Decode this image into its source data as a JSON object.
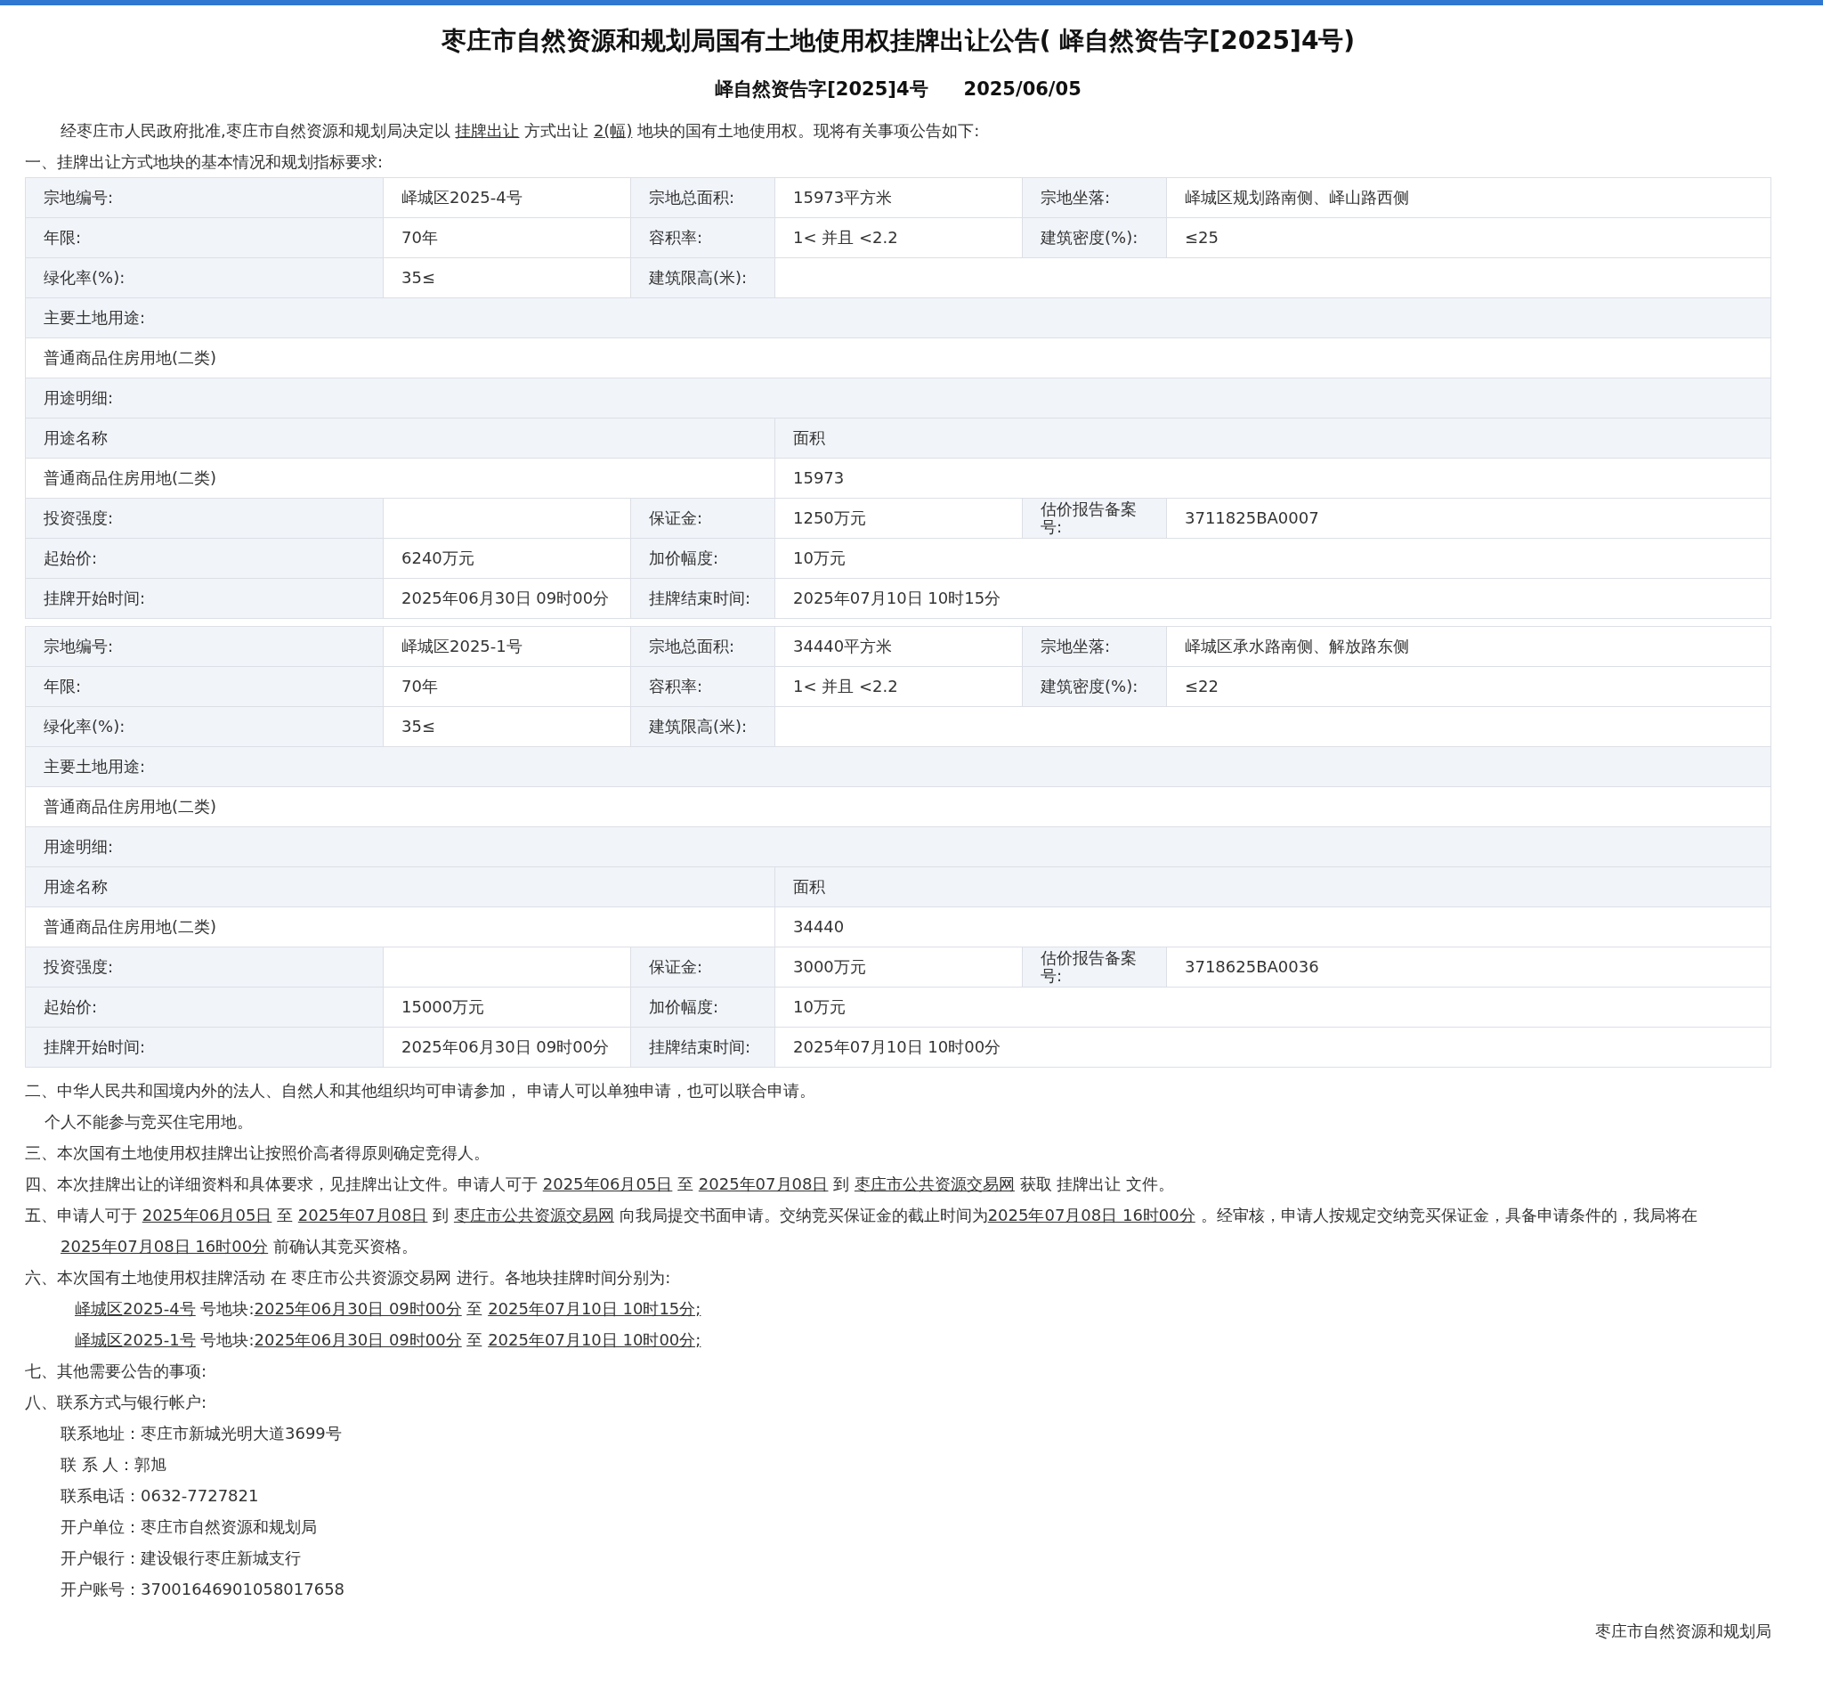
{
  "title": "枣庄市自然资源和规划局国有土地使用权挂牌出让公告( 峄自然资告字[2025]4号)",
  "subtitle": {
    "doc_no": "峄自然资告字[2025]4号",
    "date": "2025/06/05"
  },
  "intro": [
    {
      "text": "经枣庄市人民政府批准,枣庄市自然资源和规划局决定以 "
    },
    {
      "text": "挂牌出让",
      "link": true
    },
    {
      "text": " 方式出让 "
    },
    {
      "text": "2(幅)",
      "link": true
    },
    {
      "text": " 地块的国有土地使用权。现将有关事项公告如下:"
    }
  ],
  "section_heading": "一、挂牌出让方式地块的基本情况和规划指标要求:",
  "parcels": [
    {
      "rows": [
        [
          {
            "kind": "label",
            "text": "宗地编号:"
          },
          {
            "kind": "value",
            "text": "峄城区2025-4号"
          },
          {
            "kind": "label",
            "text": "宗地总面积:"
          },
          {
            "kind": "value",
            "text": "15973平方米"
          },
          {
            "kind": "label",
            "text": "宗地坐落:"
          },
          {
            "kind": "value",
            "text": "峄城区规划路南侧、峄山路西侧"
          }
        ],
        [
          {
            "kind": "label",
            "text": "年限:"
          },
          {
            "kind": "value",
            "text": "70年"
          },
          {
            "kind": "label",
            "text": "容积率:"
          },
          {
            "kind": "value",
            "text": "1< 并且 <2.2"
          },
          {
            "kind": "label",
            "text": "建筑密度(%):"
          },
          {
            "kind": "value",
            "text": "≤25"
          }
        ],
        [
          {
            "kind": "label",
            "text": "绿化率(%):"
          },
          {
            "kind": "value",
            "text": "35≤"
          },
          {
            "kind": "label",
            "text": "建筑限高(米):"
          },
          {
            "kind": "blank",
            "colspan": 3
          }
        ],
        [
          {
            "kind": "label",
            "text": "主要土地用途:",
            "colspan": 6
          }
        ],
        [
          {
            "kind": "value",
            "text": "普通商品住房用地(二类)",
            "colspan": 6
          }
        ],
        [
          {
            "kind": "label",
            "text": "用途明细:",
            "colspan": 6
          }
        ],
        [
          {
            "kind": "label",
            "text": "用途名称",
            "colspan": 3
          },
          {
            "kind": "label",
            "text": "面积",
            "colspan": 3
          }
        ],
        [
          {
            "kind": "value",
            "text": "普通商品住房用地(二类)",
            "colspan": 3
          },
          {
            "kind": "value",
            "text": "15973",
            "colspan": 3
          }
        ],
        [
          {
            "kind": "label",
            "text": "投资强度:"
          },
          {
            "kind": "blank"
          },
          {
            "kind": "label",
            "text": "保证金:"
          },
          {
            "kind": "value",
            "text": "1250万元"
          },
          {
            "kind": "label",
            "text": "估价报告备案号:"
          },
          {
            "kind": "value",
            "text": "3711825BA0007"
          }
        ],
        [
          {
            "kind": "label",
            "text": "起始价:"
          },
          {
            "kind": "value",
            "text": "6240万元"
          },
          {
            "kind": "label",
            "text": "加价幅度:"
          },
          {
            "kind": "value",
            "text": "10万元",
            "colspan": 3
          }
        ],
        [
          {
            "kind": "label",
            "text": "挂牌开始时间:"
          },
          {
            "kind": "value",
            "text": "2025年06月30日 09时00分"
          },
          {
            "kind": "label",
            "text": "挂牌结束时间:"
          },
          {
            "kind": "value",
            "text": "2025年07月10日 10时15分",
            "colspan": 3
          }
        ]
      ]
    },
    {
      "rows": [
        [
          {
            "kind": "label",
            "text": "宗地编号:"
          },
          {
            "kind": "value",
            "text": "峄城区2025-1号"
          },
          {
            "kind": "label",
            "text": "宗地总面积:"
          },
          {
            "kind": "value",
            "text": "34440平方米"
          },
          {
            "kind": "label",
            "text": "宗地坐落:"
          },
          {
            "kind": "value",
            "text": "峄城区承水路南侧、解放路东侧"
          }
        ],
        [
          {
            "kind": "label",
            "text": "年限:"
          },
          {
            "kind": "value",
            "text": "70年"
          },
          {
            "kind": "label",
            "text": "容积率:"
          },
          {
            "kind": "value",
            "text": "1< 并且 <2.2"
          },
          {
            "kind": "label",
            "text": "建筑密度(%):"
          },
          {
            "kind": "value",
            "text": "≤22"
          }
        ],
        [
          {
            "kind": "label",
            "text": "绿化率(%):"
          },
          {
            "kind": "value",
            "text": "35≤"
          },
          {
            "kind": "label",
            "text": "建筑限高(米):"
          },
          {
            "kind": "blank",
            "colspan": 3
          }
        ],
        [
          {
            "kind": "label",
            "text": "主要土地用途:",
            "colspan": 6
          }
        ],
        [
          {
            "kind": "value",
            "text": "普通商品住房用地(二类)",
            "colspan": 6
          }
        ],
        [
          {
            "kind": "label",
            "text": "用途明细:",
            "colspan": 6
          }
        ],
        [
          {
            "kind": "label",
            "text": "用途名称",
            "colspan": 3
          },
          {
            "kind": "label",
            "text": "面积",
            "colspan": 3
          }
        ],
        [
          {
            "kind": "value",
            "text": "普通商品住房用地(二类)",
            "colspan": 3
          },
          {
            "kind": "value",
            "text": "34440",
            "colspan": 3
          }
        ],
        [
          {
            "kind": "label",
            "text": "投资强度:"
          },
          {
            "kind": "blank"
          },
          {
            "kind": "label",
            "text": "保证金:"
          },
          {
            "kind": "value",
            "text": "3000万元"
          },
          {
            "kind": "label",
            "text": "估价报告备案号:"
          },
          {
            "kind": "value",
            "text": "3718625BA0036"
          }
        ],
        [
          {
            "kind": "label",
            "text": "起始价:"
          },
          {
            "kind": "value",
            "text": "15000万元"
          },
          {
            "kind": "label",
            "text": "加价幅度:"
          },
          {
            "kind": "value",
            "text": "10万元",
            "colspan": 3
          }
        ],
        [
          {
            "kind": "label",
            "text": "挂牌开始时间:"
          },
          {
            "kind": "value",
            "text": "2025年06月30日 09时00分"
          },
          {
            "kind": "label",
            "text": "挂牌结束时间:"
          },
          {
            "kind": "value",
            "text": "2025年07月10日 10时00分",
            "colspan": 3
          }
        ]
      ]
    }
  ],
  "paragraphs": [
    {
      "kind": "item",
      "parts": [
        {
          "text": "二、中华人民共和国境内外的法人、自然人和其他组织均可申请参加， 申请人可以单独申请，也可以联合申请。"
        }
      ]
    },
    {
      "kind": "note",
      "parts": [
        {
          "text": "个人不能参与竞买住宅用地。"
        }
      ]
    },
    {
      "kind": "item",
      "parts": [
        {
          "text": "三、本次国有土地使用权挂牌出让按照价高者得原则确定竞得人。"
        }
      ]
    },
    {
      "kind": "item",
      "parts": [
        {
          "text": "四、本次挂牌出让的详细资料和具体要求，见挂牌出让文件。申请人可于 "
        },
        {
          "text": "2025年06月05日",
          "link": true
        },
        {
          "text": " 至 "
        },
        {
          "text": "2025年07月08日",
          "link": true
        },
        {
          "text": " 到 "
        },
        {
          "text": "枣庄市公共资源交易网",
          "link": true
        },
        {
          "text": " 获取 挂牌出让 文件。"
        }
      ]
    },
    {
      "kind": "item",
      "parts": [
        {
          "text": "五、申请人可于 "
        },
        {
          "text": "2025年06月05日",
          "link": true
        },
        {
          "text": " 至 "
        },
        {
          "text": "2025年07月08日",
          "link": true
        },
        {
          "text": " 到 "
        },
        {
          "text": "枣庄市公共资源交易网",
          "link": true
        },
        {
          "text": " 向我局提交书面申请。交纳竞买保证金的截止时间为"
        },
        {
          "text": "2025年07月08日 16时00分",
          "link": true
        },
        {
          "text": " 。经审核，申请人按规定交纳竞买保证金，具备申请条件的，我局将在 "
        },
        {
          "text": "2025年07月08日 16时00分",
          "link": true
        },
        {
          "text": " 前确认其竞买资格。"
        }
      ]
    },
    {
      "kind": "item",
      "parts": [
        {
          "text": "六、本次国有土地使用权挂牌活动 在 枣庄市公共资源交易网 进行。各地块挂牌时间分别为:"
        }
      ]
    },
    {
      "kind": "schedule",
      "parts": [
        {
          "text": "峄城区2025-4号",
          "link": true
        },
        {
          "text": " 号地块:"
        },
        {
          "text": "2025年06月30日 09时00分",
          "link": true
        },
        {
          "text": " 至 "
        },
        {
          "text": "2025年07月10日 10时15分;",
          "link": true
        }
      ]
    },
    {
      "kind": "schedule",
      "parts": [
        {
          "text": "峄城区2025-1号",
          "link": true
        },
        {
          "text": " 号地块:"
        },
        {
          "text": "2025年06月30日 09时00分",
          "link": true
        },
        {
          "text": " 至 "
        },
        {
          "text": "2025年07月10日 10时00分;",
          "link": true
        }
      ]
    },
    {
      "kind": "item",
      "parts": [
        {
          "text": "七、其他需要公告的事项:"
        }
      ]
    },
    {
      "kind": "item",
      "parts": [
        {
          "text": "八、联系方式与银行帐户:"
        }
      ]
    },
    {
      "kind": "contact",
      "parts": [
        {
          "text": "联系地址：枣庄市新城光明大道3699号"
        }
      ]
    },
    {
      "kind": "contact",
      "parts": [
        {
          "text": "联 系 人：郭旭"
        }
      ]
    },
    {
      "kind": "contact",
      "parts": [
        {
          "text": "联系电话：0632-7727821"
        }
      ]
    },
    {
      "kind": "contact",
      "parts": [
        {
          "text": "开户单位：枣庄市自然资源和规划局"
        }
      ]
    },
    {
      "kind": "contact",
      "parts": [
        {
          "text": "开户银行：建设银行枣庄新城支行"
        }
      ]
    },
    {
      "kind": "contact",
      "parts": [
        {
          "text": "开户账号：37001646901058017658"
        }
      ]
    }
  ],
  "signature": "枣庄市自然资源和规划局"
}
